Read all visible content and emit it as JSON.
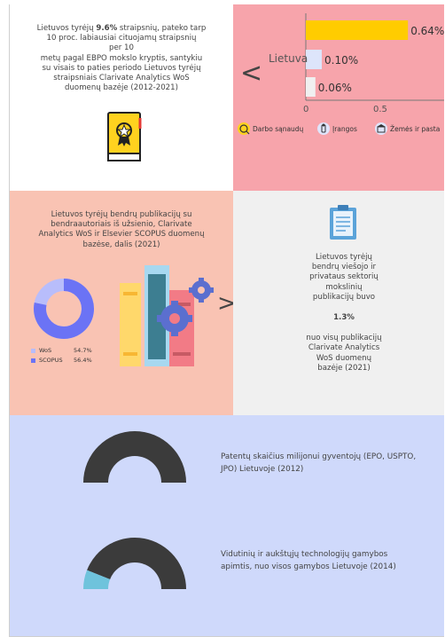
{
  "top_left": {
    "line1_pre": "Lietuvos tyrėjų ",
    "line1_bold": "9.6%",
    "line1_post": " straipsnių, pateko tarp",
    "line2": "10 proc. labiausiai cituojamų straipsnių",
    "line3": "per 10",
    "line4": "metų pagal EBPO mokslo kryptis, santykiu",
    "line5": "su visais to paties periodo Lietuvos tyrėjų",
    "line6": "straipsniais Clarivate Analytics WoS",
    "line7": "duomenų bazėje (2012-2021)",
    "icon": "award-book-icon"
  },
  "bar_chart_panel": {
    "prev_arrow": "<",
    "category_label": "Lietuva",
    "value_labels": [
      "0.64%",
      "0.10%",
      "0.06%"
    ],
    "tick_labels": [
      "0",
      "0.5"
    ],
    "legend": [
      {
        "label": "Darbo sąnaudų",
        "icon": "coin-icon"
      },
      {
        "label": "Įrangos",
        "icon": "tools-icon"
      },
      {
        "label": "Žemės ir pasta",
        "icon": "building-icon"
      }
    ],
    "colors": {
      "bar1": "#ffcc00",
      "bar2": "#dde5fb",
      "bar3": "#f0f0f0"
    }
  },
  "chart_data": {
    "type": "bar",
    "orientation": "horizontal",
    "categories": [
      "Lietuva"
    ],
    "series": [
      {
        "name": "Darbo sąnaudų",
        "values": [
          0.64
        ]
      },
      {
        "name": "Įrangos",
        "values": [
          0.1
        ]
      },
      {
        "name": "Žemės ir pasta",
        "values": [
          0.06
        ]
      }
    ],
    "xlim": [
      0,
      0.7
    ],
    "unit": "%"
  },
  "mid_left": {
    "line1": "Lietuvos tyrėjų bendrų publikacijų su",
    "line2": "bendraautoriais iš užsienio, Clarivate",
    "line3": "Analytics WoS ir Elsevier SCOPUS duomenų",
    "line4": "bazėse, dalis (2021)",
    "pie_legend": [
      {
        "label": "WoS",
        "value": "54.7%",
        "color": "#b8bdfb"
      },
      {
        "label": "SCOPUS",
        "value": "56.4%",
        "color": "#6b73f5"
      }
    ],
    "next_arrow": ">",
    "illustration": "books-gears-icon"
  },
  "mid_right": {
    "icon": "clipboard-icon",
    "line1": "Lietuvos tyrėjų",
    "line2": "bendrų viešojo ir",
    "line3": "privataus sektorių",
    "line4": "mokslinių",
    "line5": "publikacijų buvo",
    "stat": "1.3%",
    "line6": "nuo visų publikacijų",
    "line7": "Clarivate Analytics",
    "line8": "WoS duomenų",
    "line9": "bazėje (2021)"
  },
  "bottom": {
    "gauge1_line1": "Patentų skaičius milijonui gyventojų (EPO, USPTO,",
    "gauge1_line2": "JPO) Lietuvoje (2012)",
    "gauge1_fill": 0.0,
    "gauge2_line1": "Vidutinių ir aukštųjų technologijų gamybos",
    "gauge2_line2": "apimtis, nuo visos gamybos Lietuvoje (2014)",
    "gauge2_fill": 0.12,
    "colors": {
      "track": "#3b3b3b",
      "fill": "#6fc3dc"
    }
  }
}
